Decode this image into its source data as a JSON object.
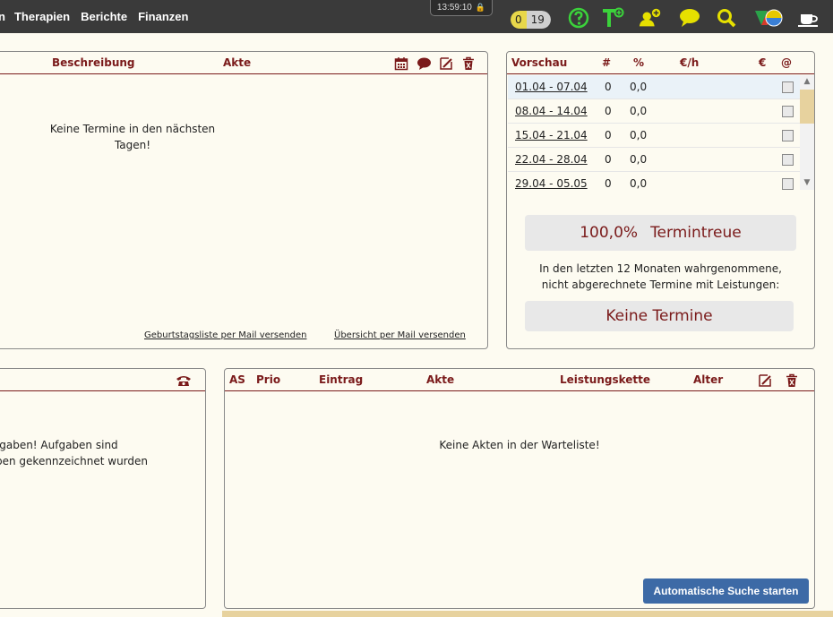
{
  "nav": {
    "items": [
      "n",
      "Therapien",
      "Berichte",
      "Finanzen"
    ]
  },
  "clock": {
    "time": "13:59:10"
  },
  "counter": {
    "a": "0",
    "b": "19"
  },
  "toolbar_icons": [
    "help-icon",
    "therapist-add-icon",
    "user-add-icon",
    "chat-icon",
    "search-icon",
    "globe-icon",
    "coffee-icon"
  ],
  "appointments": {
    "headers": {
      "description": "Beschreibung",
      "file": "Akte"
    },
    "empty_line1": "Keine Termine in den nächsten",
    "empty_line2": "Tagen!",
    "link_birthday": "Geburtstagsliste per Mail versenden",
    "link_overview": "Übersicht per Mail versenden"
  },
  "preview": {
    "headers": {
      "week": "Vorschau",
      "count": "#",
      "percent": "%",
      "per_hour": "€/h",
      "euro": "€",
      "mail": "@"
    },
    "rows": [
      {
        "range": "01.04 - 07.04",
        "count": "0",
        "pct": "0,0"
      },
      {
        "range": "08.04 - 14.04",
        "count": "0",
        "pct": "0,0"
      },
      {
        "range": "15.04 - 21.04",
        "count": "0",
        "pct": "0,0"
      },
      {
        "range": "22.04 - 28.04",
        "count": "0",
        "pct": "0,0"
      },
      {
        "range": "29.04 - 05.05",
        "count": "0",
        "pct": "0,0"
      }
    ],
    "loyalty_value": "100,0%",
    "loyalty_label": "Termintreue",
    "info_line1": "In den letzten 12 Monaten wahrgenommene,",
    "info_line2": "nicht abgerechnete Termine mit Leistungen:",
    "no_appointments": "Keine Termine"
  },
  "tasks": {
    "line1": "fgaben! Aufgaben sind",
    "line2": "pen gekennzeichnet wurden"
  },
  "waitlist": {
    "headers": {
      "as": "AS",
      "prio": "Prio",
      "entry": "Eintrag",
      "file": "Akte",
      "chain": "Leistungskette",
      "age": "Alter"
    },
    "empty": "Keine Akten in der Warteliste!",
    "search_button": "Automatische Suche starten"
  }
}
